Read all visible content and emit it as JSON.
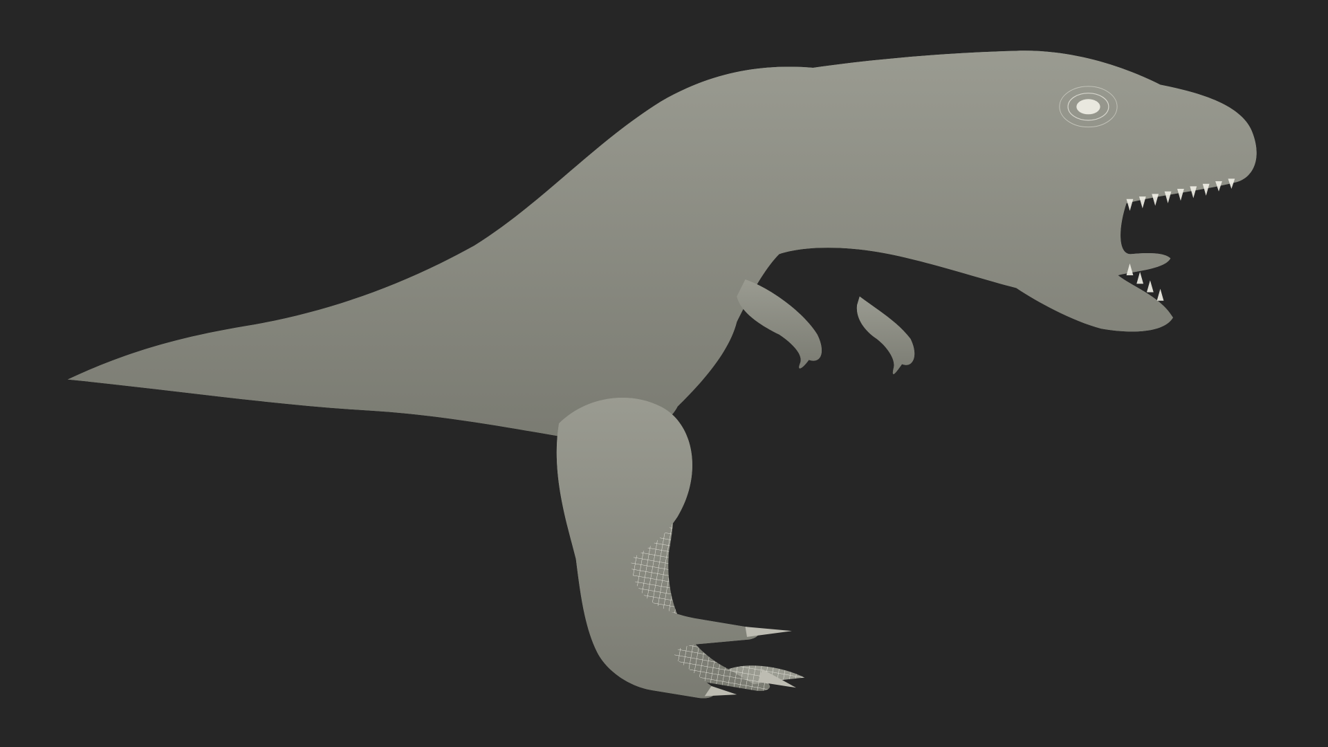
{
  "scene": {
    "background_color": "#262626",
    "model_fill_color": "#8e8f85",
    "model_shadow_color": "#6f7068",
    "wire_color": "#f2f1e8",
    "render_mode": "wireframe-on-shaded",
    "subject_icon": "t-rex-model-icon"
  }
}
